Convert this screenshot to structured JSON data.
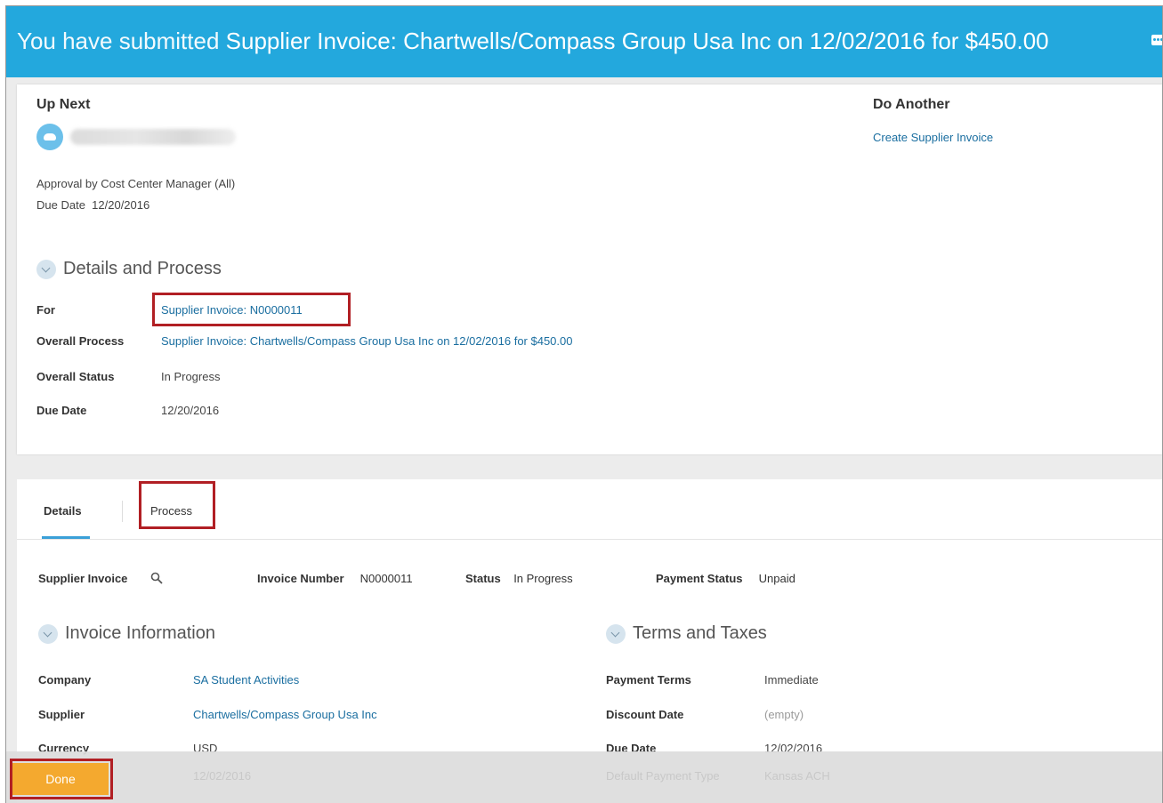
{
  "banner": {
    "prefix": "You have submitted",
    "title": "Supplier Invoice: Chartwells/Compass Group Usa Inc on 12/02/2016 for $450.00"
  },
  "up_next": {
    "heading": "Up Next",
    "step": "Approval by Cost Center Manager (All)",
    "due_label": "Due Date",
    "due_value": "12/20/2016"
  },
  "do_another": {
    "heading": "Do Another",
    "link": "Create Supplier Invoice"
  },
  "details_process": {
    "heading": "Details and Process",
    "rows": [
      {
        "label": "For",
        "value": "Supplier Invoice: N0000011"
      },
      {
        "label": "Overall Process",
        "value": "Supplier Invoice: Chartwells/Compass Group Usa Inc on 12/02/2016 for $450.00"
      },
      {
        "label": "Overall Status",
        "value": "In Progress"
      },
      {
        "label": "Due Date",
        "value": "12/20/2016"
      }
    ]
  },
  "tabs": {
    "details": "Details",
    "process": "Process"
  },
  "summary": {
    "supplier_invoice_label": "Supplier Invoice",
    "invoice_number_label": "Invoice Number",
    "invoice_number_value": "N0000011",
    "status_label": "Status",
    "status_value": "In Progress",
    "payment_status_label": "Payment Status",
    "payment_status_value": "Unpaid"
  },
  "invoice_information": {
    "heading": "Invoice Information",
    "rows": [
      {
        "label": "Company",
        "value": "SA Student Activities"
      },
      {
        "label": "Supplier",
        "value": "Chartwells/Compass Group Usa Inc"
      },
      {
        "label": "Currency",
        "value": "USD"
      }
    ],
    "faded_value": "12/02/2016"
  },
  "terms_and_taxes": {
    "heading": "Terms and Taxes",
    "rows": [
      {
        "label": "Payment Terms",
        "value": "Immediate"
      },
      {
        "label": "Discount Date",
        "value": "(empty)"
      },
      {
        "label": "Due Date",
        "value": "12/02/2016"
      }
    ],
    "faded_label": "Default Payment Type",
    "faded_value": "Kansas ACH"
  },
  "footer": {
    "done_label": "Done"
  },
  "colors": {
    "banner": "#23a8dd",
    "link": "#1a6ea0",
    "done": "#f4a92f",
    "highlight": "#b11f24"
  }
}
